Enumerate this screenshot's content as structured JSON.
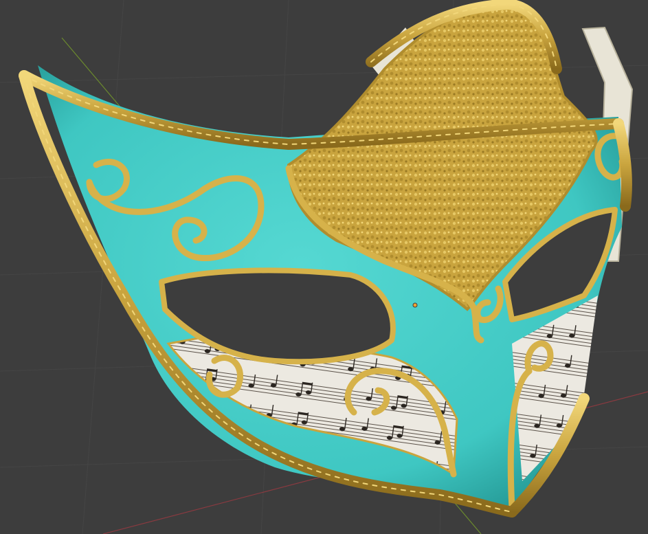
{
  "viewport": {
    "background": "#3d3d3d",
    "grid_color": "#454545",
    "x_axis_color": "#8a3a40",
    "y_axis_color": "#6b8a2e",
    "origin_color": "#f0a030"
  },
  "model": {
    "teal": "#3fc7c2",
    "teal_dark": "#1f8f8c",
    "gold": "#d6b24a",
    "gold_light": "#f2d77a",
    "gold_dark": "#8a6a1c",
    "paper": "#ece9e1",
    "ink": "#2a2520"
  }
}
